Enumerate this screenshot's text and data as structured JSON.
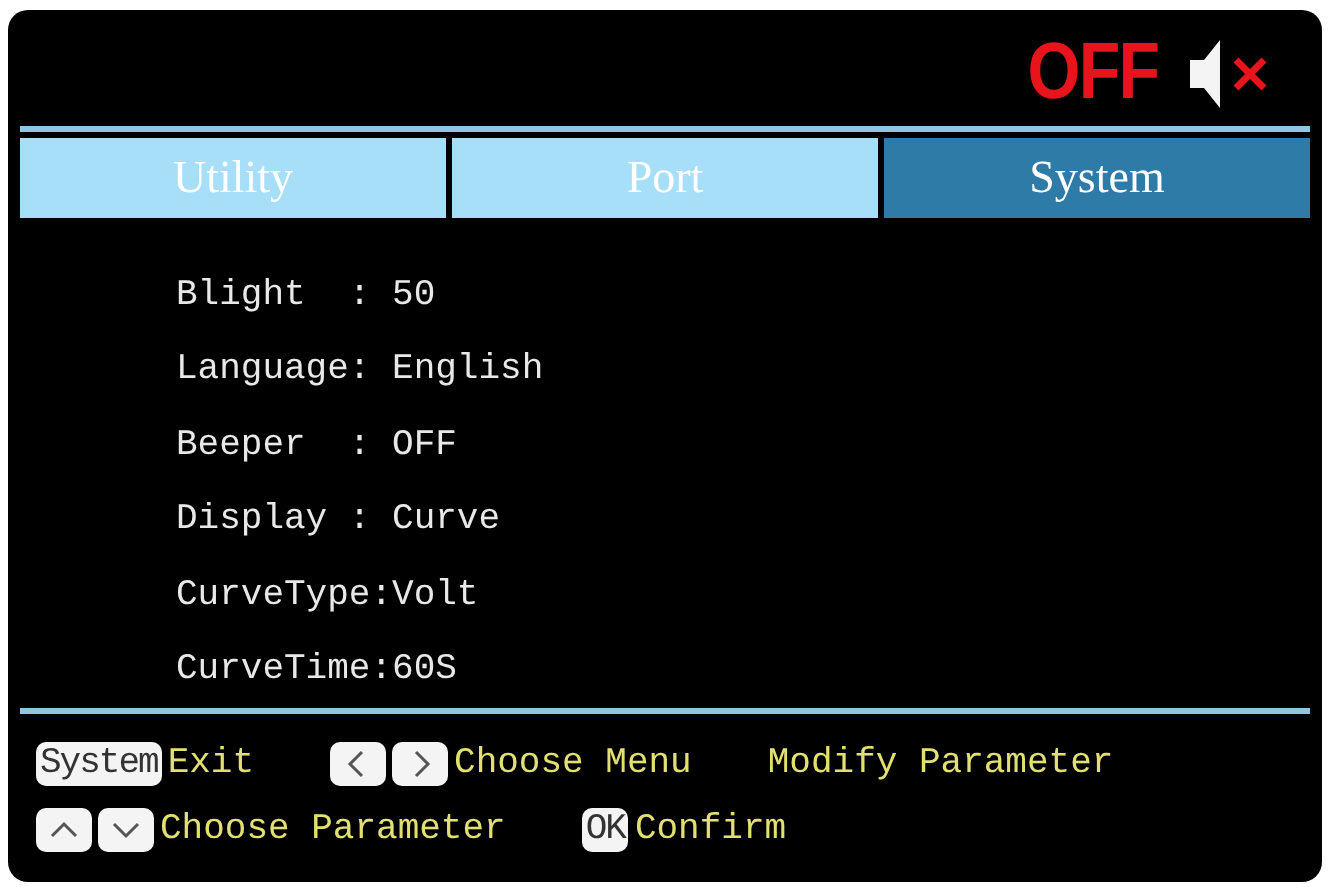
{
  "status": {
    "label": "OFF",
    "muted": true
  },
  "tabs": [
    {
      "label": "Utility",
      "selected": false
    },
    {
      "label": "Port",
      "selected": false
    },
    {
      "label": "System",
      "selected": true
    }
  ],
  "settings": [
    {
      "label": "Blight  :",
      "value": "50"
    },
    {
      "label": "Language:",
      "value": "English"
    },
    {
      "label": "Beeper  :",
      "value": "OFF"
    },
    {
      "label": "Display :",
      "value": "Curve"
    },
    {
      "label": "CurveType:",
      "value": "Volt"
    },
    {
      "label": "CurveTime:",
      "value": "60S"
    }
  ],
  "hints": [
    [
      {
        "keys": [
          {
            "kind": "text",
            "text": "System"
          }
        ],
        "text": "Exit"
      },
      {
        "keys": [
          {
            "kind": "left"
          },
          {
            "kind": "right"
          }
        ],
        "text": "Choose Menu"
      },
      {
        "text": "Modify Parameter"
      }
    ],
    [
      {
        "keys": [
          {
            "kind": "up"
          },
          {
            "kind": "down"
          }
        ],
        "text": "Choose Parameter"
      },
      {
        "keys": [
          {
            "kind": "text",
            "text": "OK"
          }
        ],
        "text": "Confirm"
      }
    ]
  ]
}
